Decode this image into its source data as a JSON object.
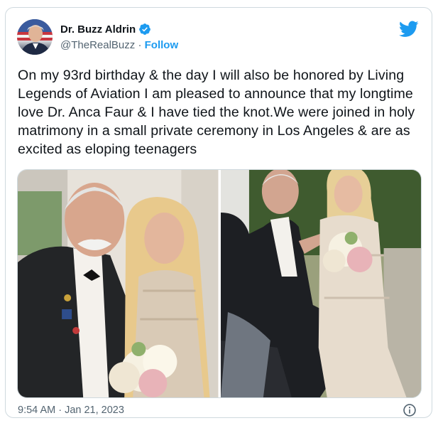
{
  "author": {
    "display_name": "Dr. Buzz Aldrin",
    "handle": "@TheRealBuzz",
    "separator": " · ",
    "follow_label": "Follow",
    "verified_color": "#1d9bf0"
  },
  "tweet": {
    "text": "On my 93rd birthday & the day I will also be honored by Living Legends of Aviation I am pleased to announce that my longtime love Dr. Anca Faur & I have tied the knot.We were joined in holy matrimony in a small private ceremony in Los Angeles & are as excited as eloping teenagers",
    "timestamp": "9:54 AM · Jan 21, 2023"
  },
  "media": {
    "photos": [
      {
        "subject": "couple-portrait"
      },
      {
        "subject": "couple-seated-ceremony"
      }
    ]
  },
  "icons": {
    "brand": "twitter-bird-icon",
    "verified": "verified-badge-icon",
    "info": "info-icon"
  },
  "colors": {
    "accent": "#1d9bf0",
    "text_primary": "#0f1419",
    "text_secondary": "#536471",
    "border": "#cfd9de"
  }
}
